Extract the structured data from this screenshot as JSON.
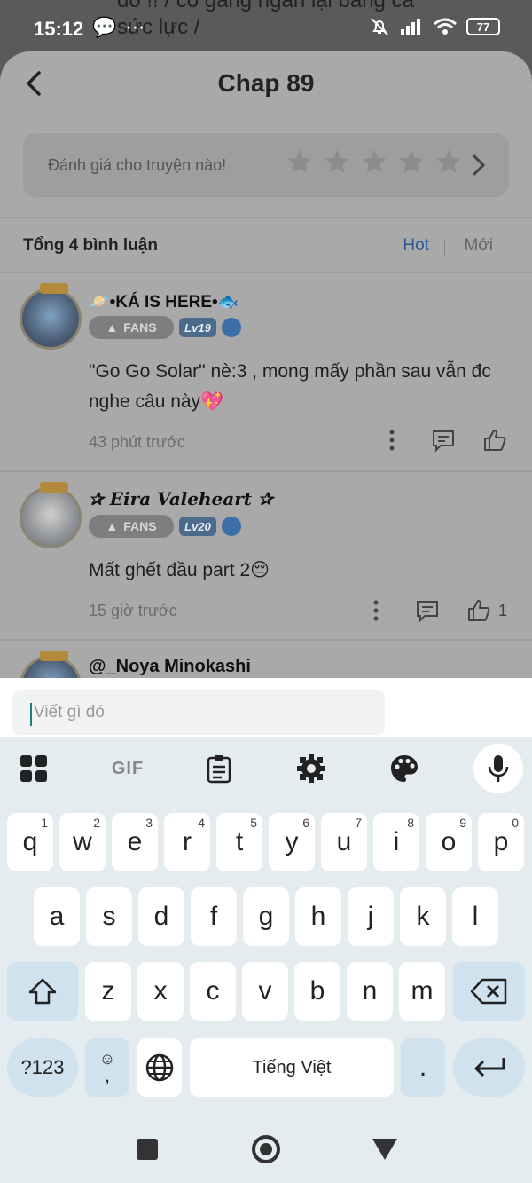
{
  "background": {
    "text": "đó !! / cố gắng ngăn lại bằng cả sức lực /"
  },
  "status_bar": {
    "time": "15:12",
    "battery": "77"
  },
  "header": {
    "title": "Chap 89"
  },
  "rating": {
    "label": "Đánh giá cho truyện nào!",
    "stars": 5
  },
  "comments_header": {
    "total": "Tổng 4 bình luận",
    "tab_hot": "Hot",
    "tab_new": "Mới"
  },
  "comments": [
    {
      "name": "🪐•KÁ IS HERE•🐟",
      "badge": "FANS",
      "level": "Lv19",
      "text": "\"Go Go Solar\" nè:3 , mong mấy phần sau vẫn đc nghe câu này💖",
      "time": "43 phút trước",
      "likes": ""
    },
    {
      "name": "✰ Eira Valeheart ✰",
      "badge": "FANS",
      "level": "Lv20",
      "text": "Mất ghết đầu part 2😔",
      "time": "15 giờ trước",
      "likes": "1"
    },
    {
      "name": "@_Noya Minokashi"
    }
  ],
  "input": {
    "placeholder": "Viết gì đó"
  },
  "keyboard": {
    "toolbar": {
      "gif": "GIF"
    },
    "row1": [
      {
        "k": "q",
        "s": "1"
      },
      {
        "k": "w",
        "s": "2"
      },
      {
        "k": "e",
        "s": "3"
      },
      {
        "k": "r",
        "s": "4"
      },
      {
        "k": "t",
        "s": "5"
      },
      {
        "k": "y",
        "s": "6"
      },
      {
        "k": "u",
        "s": "7"
      },
      {
        "k": "i",
        "s": "8"
      },
      {
        "k": "o",
        "s": "9"
      },
      {
        "k": "p",
        "s": "0"
      }
    ],
    "row2": [
      "a",
      "s",
      "d",
      "f",
      "g",
      "h",
      "j",
      "k",
      "l"
    ],
    "row3": [
      "z",
      "x",
      "c",
      "v",
      "b",
      "n",
      "m"
    ],
    "sym_label": "?123",
    "emoji_comma": ",",
    "space_label": "Tiếng Việt",
    "period": "."
  },
  "colors": {
    "accent_link": "#2b5a92",
    "key_func": "#cfe2ee",
    "keyboard_bg": "#e5ecf0"
  }
}
